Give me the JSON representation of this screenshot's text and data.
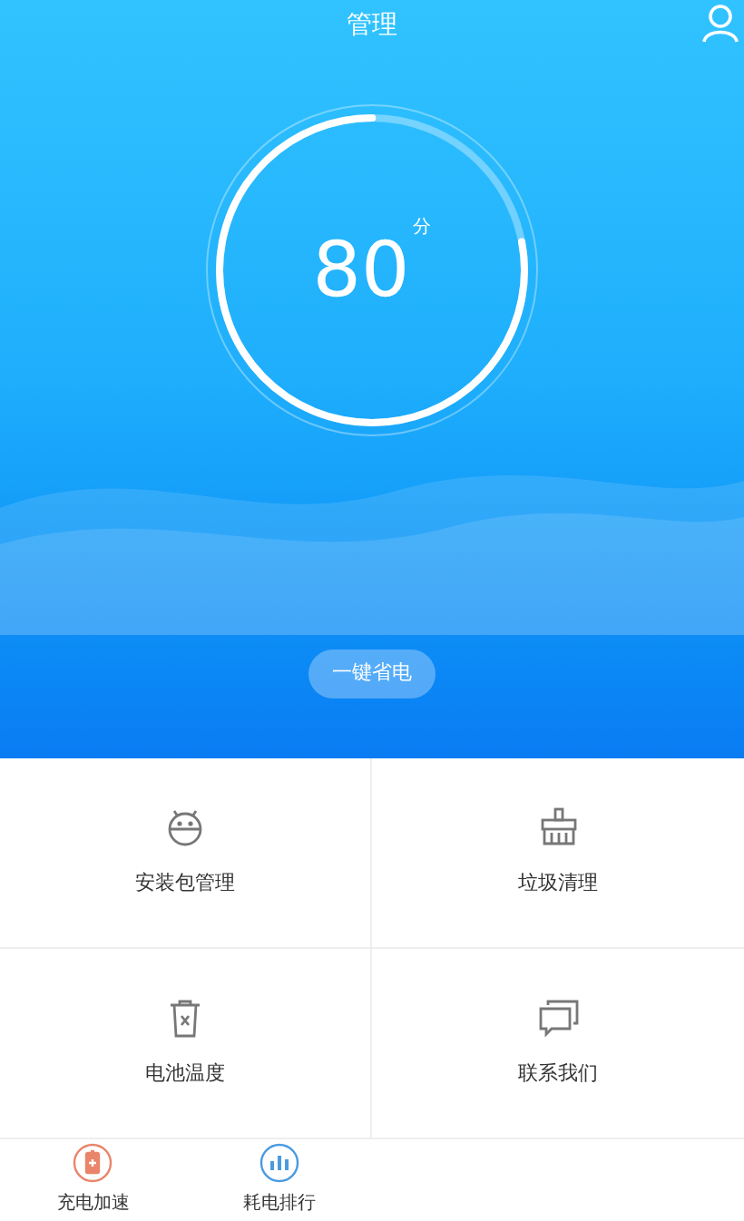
{
  "header": {
    "title": "管理"
  },
  "score": {
    "value": "80",
    "unit": "分",
    "level": 0.78
  },
  "action_button": "一键省电",
  "tiles": [
    {
      "kind": "android",
      "label": "安装包管理"
    },
    {
      "kind": "broom",
      "label": "垃圾清理"
    },
    {
      "kind": "trash",
      "label": "电池温度"
    },
    {
      "kind": "chat",
      "label": "联系我们"
    }
  ],
  "tab_bar": [
    {
      "kind": "battery",
      "label": "充电加速"
    },
    {
      "kind": "chart",
      "label": "耗电排行"
    }
  ]
}
